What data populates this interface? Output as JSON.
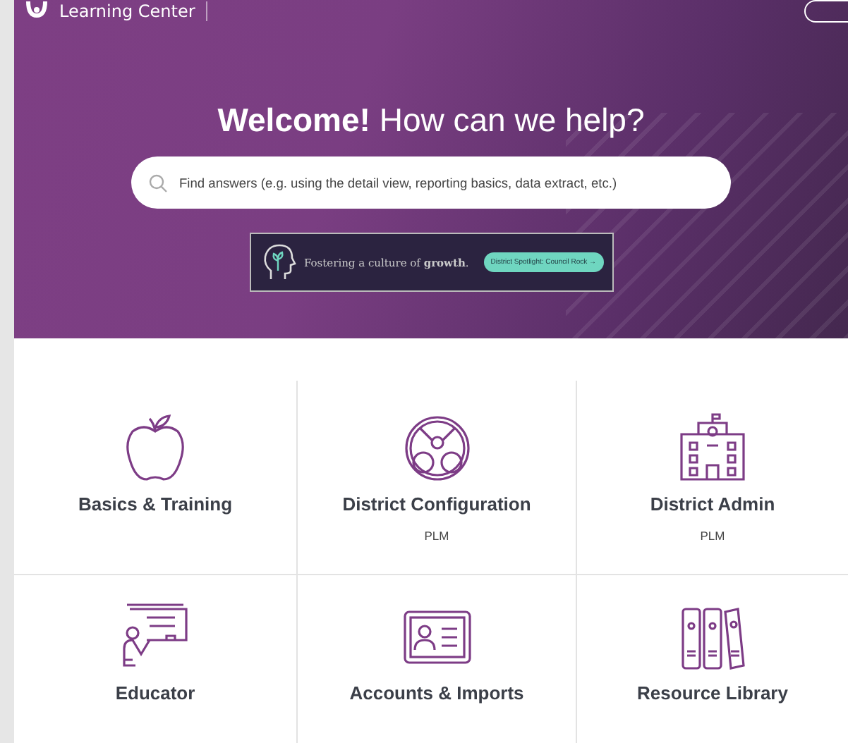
{
  "header": {
    "title": "Learning Center"
  },
  "hero": {
    "heading_bold": "Welcome!",
    "heading_rest": "How can we help?",
    "search": {
      "placeholder": "Find answers (e.g. using the detail view, reporting basics, data extract, etc.)"
    },
    "banner": {
      "text": "Fostering a culture of **growth**.",
      "button": "District Spotlight: Council Rock →"
    }
  },
  "categories": [
    {
      "kind": "apple",
      "title": "Basics & Training"
    },
    {
      "kind": "gears",
      "title": "District Configuration",
      "subtitle": "PLM"
    },
    {
      "kind": "school",
      "title": "District Admin",
      "subtitle": "PLM"
    },
    {
      "kind": "teacher",
      "title": "Educator"
    },
    {
      "kind": "idcard",
      "title": "Accounts & Imports"
    },
    {
      "kind": "binders",
      "title": "Resource Library"
    }
  ]
}
